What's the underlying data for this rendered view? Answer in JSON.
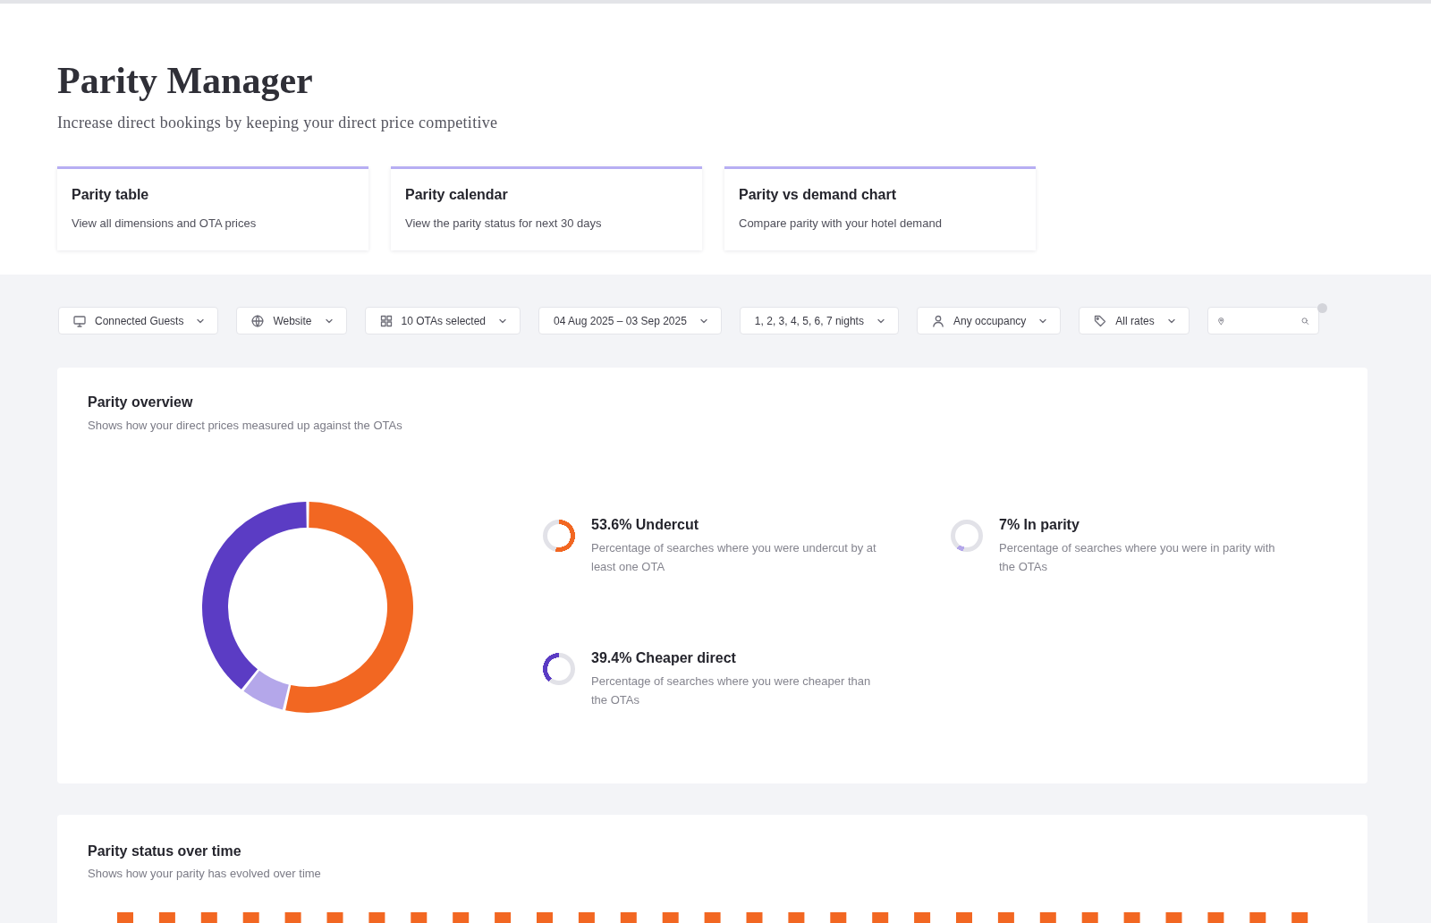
{
  "page": {
    "title": "Parity Manager",
    "subtitle": "Increase direct bookings by keeping your direct price competitive"
  },
  "nav_cards": [
    {
      "title": "Parity table",
      "description": "View all dimensions and OTA prices"
    },
    {
      "title": "Parity calendar",
      "description": "View the parity status for next 30 days"
    },
    {
      "title": "Parity vs demand chart",
      "description": "Compare parity with your hotel demand"
    }
  ],
  "filters": [
    {
      "kind": "select",
      "label": "Connected Guests"
    },
    {
      "kind": "select",
      "label": "Website"
    },
    {
      "kind": "select",
      "label": "10 OTAs selected"
    },
    {
      "kind": "select",
      "label": "04 Aug 2025 – 03 Sep 2025"
    },
    {
      "kind": "select",
      "label": "1, 2, 3, 4, 5, 6, 7 nights"
    },
    {
      "kind": "select",
      "label": "Any occupancy"
    },
    {
      "kind": "select",
      "label": "All rates"
    },
    {
      "kind": "search"
    }
  ],
  "overview": {
    "title": "Parity overview",
    "description": "Shows how your direct prices measured up against the OTAs",
    "chart_data": {
      "type": "donut",
      "values": [
        53.6,
        7,
        39.4
      ]
    },
    "stats": [
      {
        "title": "53.6% Undercut",
        "description": "Percentage of searches where you were undercut by at least one OTA",
        "color": "#f26722"
      },
      {
        "title": "7% In parity",
        "description": "Percentage of searches where you were in parity with the OTAs",
        "color": "#b4a7ea"
      },
      {
        "title": "39.4% Cheaper direct",
        "description": "Percentage of searches where you were cheaper than the OTAs",
        "color": "#5b3cc4"
      }
    ]
  },
  "timeline": {
    "title": "Parity status over time",
    "description": "Shows how your parity has evolved over time"
  }
}
